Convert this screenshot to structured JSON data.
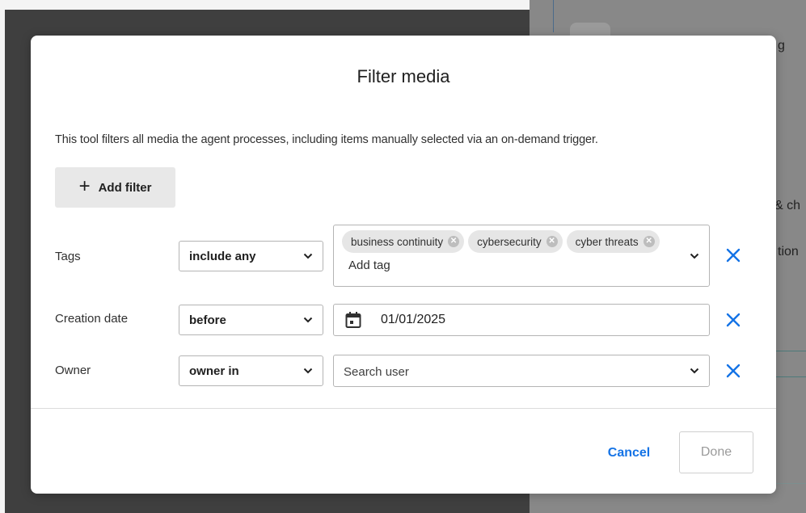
{
  "background": {
    "peek_texts": [
      "g",
      "& ch",
      "tion"
    ]
  },
  "modal": {
    "title": "Filter media",
    "description": "This tool filters all media the agent processes, including items manually selected via an on-demand trigger.",
    "add_filter_label": "Add filter",
    "filters": [
      {
        "label": "Tags",
        "operator": "include any",
        "tags": [
          "business continuity",
          "cybersecurity",
          "cyber threats"
        ],
        "input_placeholder": "Add tag"
      },
      {
        "label": "Creation date",
        "operator": "before",
        "value": "01/01/2025"
      },
      {
        "label": "Owner",
        "operator": "owner in",
        "input_placeholder": "Search user"
      }
    ],
    "cancel_label": "Cancel",
    "done_label": "Done"
  },
  "colors": {
    "accent": "#1473e6",
    "overlay_dark": "#3f3f3f",
    "chip_bg": "#e6e6e6"
  }
}
